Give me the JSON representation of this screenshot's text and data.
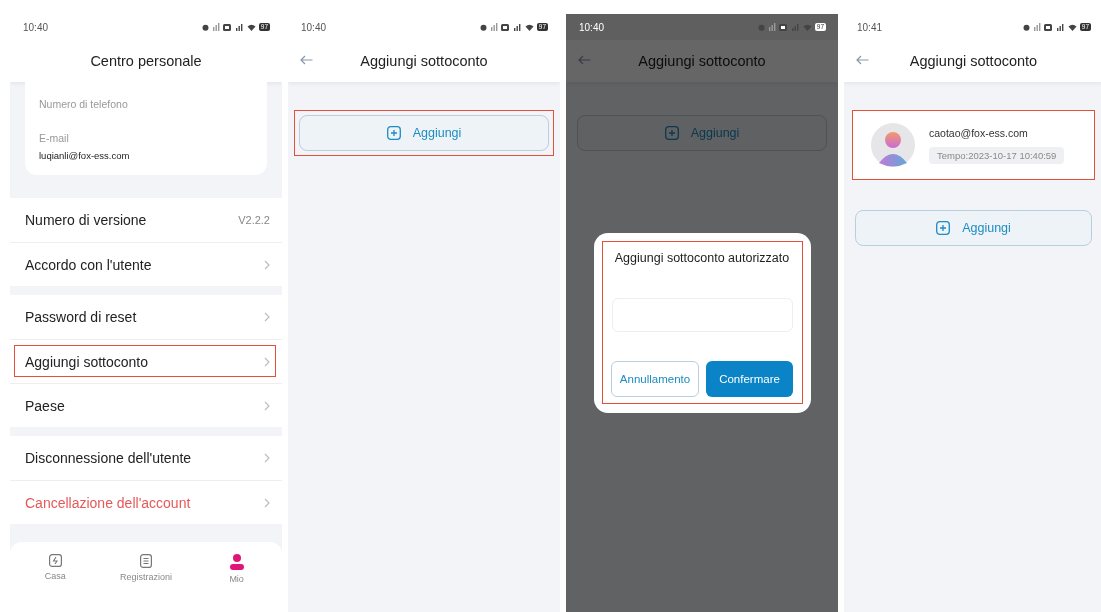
{
  "screens": [
    {
      "kind": "profile",
      "time": "10:40",
      "battery": "97",
      "title": "Centro personale",
      "profile": {
        "fields": [
          {
            "label": "Numero di telefono"
          },
          {
            "label": "E-mail",
            "value": "luqianli@fox-ess.com"
          }
        ]
      },
      "menu_groups": [
        [
          {
            "label": "Numero di versione",
            "value": "V2.2.2",
            "chevron": false,
            "danger": false,
            "highlighted": false
          },
          {
            "label": "Accordo con l'utente",
            "chevron": true,
            "danger": false,
            "highlighted": false
          }
        ],
        [
          {
            "label": "Password di reset",
            "chevron": true,
            "danger": false,
            "highlighted": false
          },
          {
            "label": "Aggiungi sottoconto",
            "chevron": true,
            "danger": false,
            "highlighted": true
          },
          {
            "label": "Paese",
            "chevron": true,
            "danger": false,
            "highlighted": false
          }
        ],
        [
          {
            "label": "Disconnessione dell'utente",
            "chevron": true,
            "danger": false,
            "highlighted": false
          },
          {
            "label": "Cancellazione dell'account",
            "chevron": true,
            "danger": true,
            "highlighted": false
          }
        ]
      ],
      "nav": [
        {
          "label": "Casa",
          "selected": false
        },
        {
          "label": "Registrazioni",
          "selected": false
        },
        {
          "label": "Mio",
          "selected": true
        }
      ]
    },
    {
      "kind": "subaccounts",
      "time": "10:40",
      "battery": "97",
      "title": "Aggiungi sottoconto",
      "has_back": true,
      "add_button": {
        "label": "Aggiungi",
        "highlighted": true
      }
    },
    {
      "kind": "subaccounts",
      "time": "10:40",
      "battery": "97",
      "title": "Aggiungi sottoconto",
      "has_back": true,
      "dimmed": true,
      "add_button": {
        "label": "Aggiungi",
        "highlighted": false
      },
      "dialog": {
        "title": "Aggiungi sottoconto autorizzato",
        "highlighted": true,
        "buttons": [
          {
            "label": "Annullamento",
            "kind": "outline"
          },
          {
            "label": "Confermare",
            "kind": "primary"
          }
        ]
      }
    },
    {
      "kind": "subaccounts",
      "time": "10:41",
      "battery": "97",
      "title": "Aggiungi sottoconto",
      "has_back": true,
      "accounts": [
        {
          "email": "caotao@fox-ess.com",
          "time": "Tempo:2023-10-17 10:40:59",
          "highlighted": true
        }
      ],
      "add_button": {
        "label": "Aggiungi",
        "highlighted": false
      }
    }
  ]
}
